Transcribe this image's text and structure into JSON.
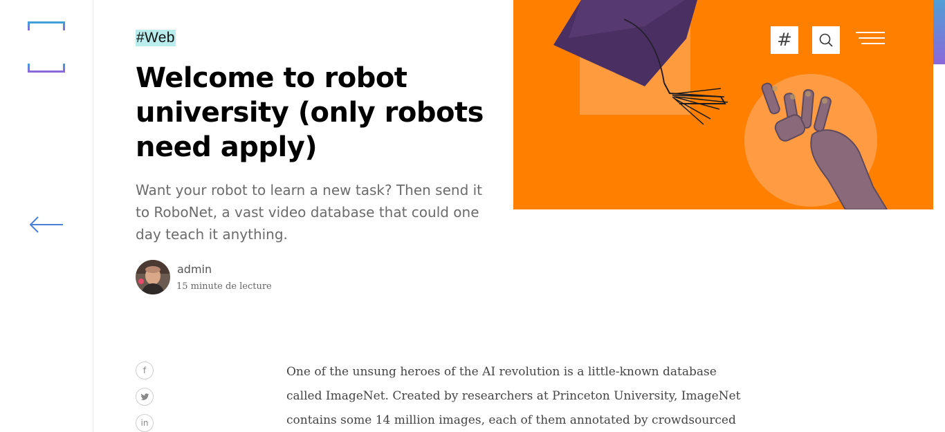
{
  "post": {
    "tag": "#Web",
    "title": "Welcome to robot university (only robots need apply)",
    "subtitle": "Want your robot to learn a new task? Then send it to RoboNet, a vast video database that could one day teach it anything.",
    "author": "admin",
    "read_time": "15 minute de lecture",
    "body_intro": "One of the unsung heroes of the AI revolution is a little-known database called ImageNet. Created by researchers at Princeton University, ImageNet contains some 14 million images, each of them annotated by crowdsourced"
  },
  "header": {
    "hash_label": "#"
  },
  "share": {
    "facebook": "f",
    "twitter": "t",
    "linkedin": "in"
  },
  "icons": {
    "logo": "bracket-logo",
    "back": "arrow-left-icon",
    "search": "search-icon",
    "menu": "hamburger-menu-icon"
  },
  "colors": {
    "hero_orange": "#ff7f00",
    "tag_highlight": "#b9ecec",
    "accent_blue": "#4f9fd6",
    "accent_purple": "#8a68d8"
  }
}
